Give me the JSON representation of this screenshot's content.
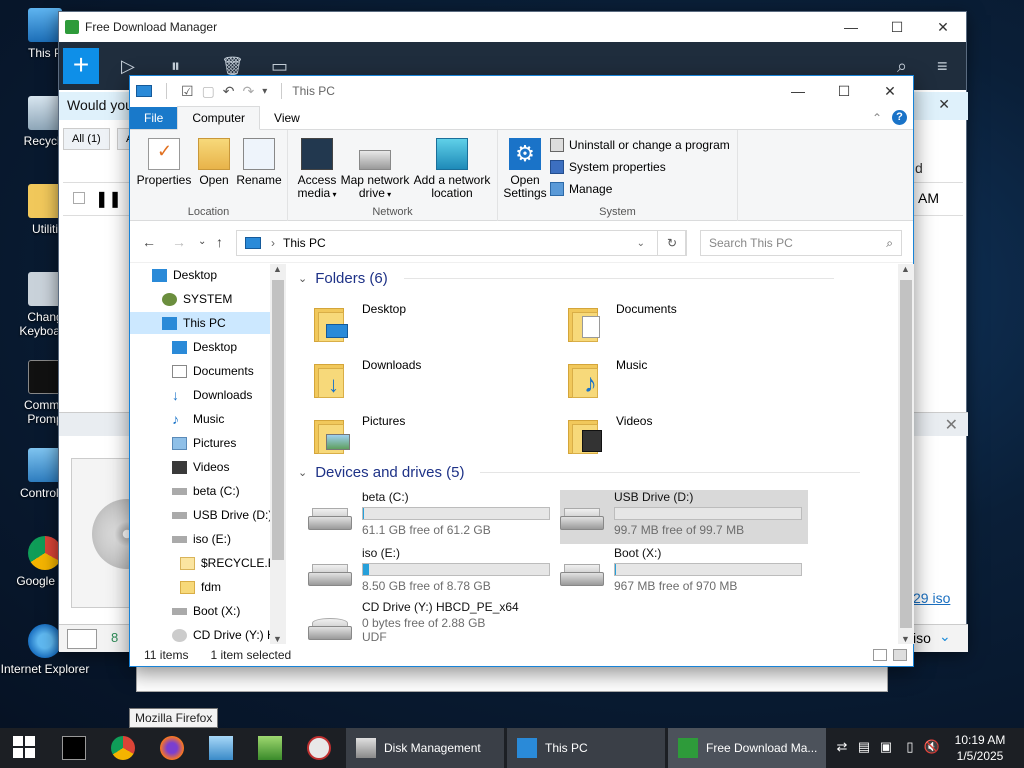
{
  "desktop": {
    "icons": [
      {
        "label": "This P"
      },
      {
        "label": "Recycle"
      },
      {
        "label": "Utiliti"
      },
      {
        "label": "Chang",
        "label2": "Keyboard"
      },
      {
        "label": "Comma",
        "label2": "Promp"
      },
      {
        "label": "Control P"
      },
      {
        "label": "Google Ch"
      },
      {
        "label": "Internet Explorer"
      }
    ]
  },
  "fdm": {
    "title": "Free Download Manager",
    "info_text": "Would you",
    "tab_all": "All (1)",
    "tab_a": "A",
    "right_d": "d",
    "right_am": "AM",
    "link_iso": "29 iso",
    "bottom_iso": "iso",
    "bottom_v": "8"
  },
  "explorer": {
    "title": "This PC",
    "tabs": {
      "file": "File",
      "computer": "Computer",
      "view": "View"
    },
    "ribbon": {
      "location": {
        "label": "Location",
        "properties": "Properties",
        "open": "Open",
        "rename": "Rename"
      },
      "network": {
        "label": "Network",
        "access_media": "Access media",
        "map_drive": "Map network drive",
        "add_location": "Add a network location"
      },
      "system": {
        "label": "System",
        "open_settings": "Open Settings",
        "uninstall": "Uninstall or change a program",
        "sys_props": "System properties",
        "manage": "Manage"
      }
    },
    "address": "This PC",
    "search_placeholder": "Search This PC",
    "nav": [
      "Desktop",
      "SYSTEM",
      "This PC",
      "Desktop",
      "Documents",
      "Downloads",
      "Music",
      "Pictures",
      "Videos",
      "beta (C:)",
      "USB Drive (D:)",
      "iso (E:)",
      "$RECYCLE.BIN",
      "fdm",
      "Boot (X:)",
      "CD Drive (Y:) H"
    ],
    "folders_header": "Folders (6)",
    "folders": [
      "Desktop",
      "Documents",
      "Downloads",
      "Music",
      "Pictures",
      "Videos"
    ],
    "drives_header": "Devices and drives (5)",
    "drives": [
      {
        "name": "beta (C:)",
        "free": "61.1 GB free of 61.2 GB",
        "used": 0.002
      },
      {
        "name": "USB Drive (D:)",
        "free": "99.7 MB free of 99.7 MB",
        "used": 0.0
      },
      {
        "name": "iso (E:)",
        "free": "8.50 GB free of 8.78 GB",
        "used": 0.03
      },
      {
        "name": "Boot (X:)",
        "free": "967 MB free of 970 MB",
        "used": 0.003
      },
      {
        "name": "CD Drive (Y:) HBCD_PE_x64",
        "free": "0 bytes free of 2.88 GB",
        "extra": "UDF"
      }
    ],
    "status_count": "11 items",
    "status_selected": "1 item selected"
  },
  "tooltip": "Mozilla Firefox",
  "taskbar": {
    "windows": [
      {
        "label": "Disk Management"
      },
      {
        "label": "This PC"
      },
      {
        "label": "Free Download Ma..."
      }
    ],
    "time": "10:19 AM",
    "date": "1/5/2025"
  }
}
